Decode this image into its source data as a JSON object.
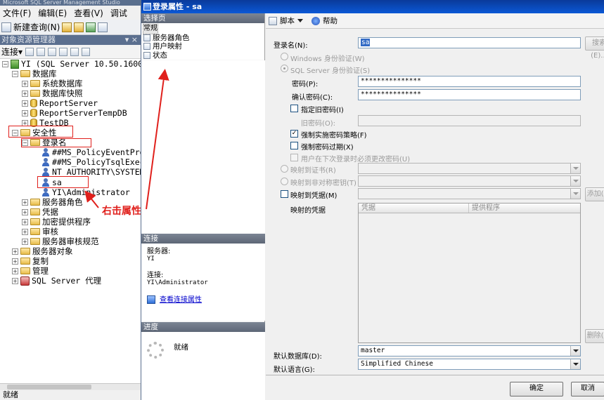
{
  "ssms": {
    "title": "Microsoft SQL Server Management Studio",
    "menu": [
      "文件(F)",
      "编辑(E)",
      "查看(V)",
      "调试"
    ],
    "toolbar_new_query": "新建查询(N)",
    "object_explorer_title": "对象资源管理器",
    "pin": "▾ ×",
    "connect_label": "连接▾",
    "status": "就绪"
  },
  "tree": {
    "server": "YI (SQL Server 10.50.1600 -",
    "databases": "数据库",
    "system_databases": "系统数据库",
    "db_snapshots": "数据库快照",
    "report_server": "ReportServer",
    "report_server_temp": "ReportServerTempDB",
    "testdb": "TestDB",
    "security": "安全性",
    "logins": "登录名",
    "login_1": "##MS_PolicyEventProc",
    "login_2": "##MS_PolicyTsqlExecu",
    "login_3": "NT AUTHORITY\\SYSTEM",
    "login_sa": "sa",
    "login_admin": "YI\\Administrator",
    "server_roles": "服务器角色",
    "credentials": "凭据",
    "crypto_providers": "加密提供程序",
    "audits": "审核",
    "audit_specs": "服务器审核规范",
    "server_objects": "服务器对象",
    "replication": "复制",
    "management": "管理",
    "agent": "SQL Server 代理"
  },
  "annotation": "右击属性",
  "dialog": {
    "title": "登录属性 - sa",
    "select_page": "选择页",
    "pages": [
      "常规",
      "服务器角色",
      "用户映射",
      "状态"
    ],
    "connection_header": "连接",
    "server_label": "服务器:",
    "server_value": "YI",
    "connection_label": "连接:",
    "connection_value": "YI\\Administrator",
    "view_conn_props": "查看连接属性",
    "progress_header": "进度",
    "progress_status": "就绪",
    "script": "脚本",
    "help": "帮助",
    "login_name_label": "登录名(N):",
    "login_name_value": "sa",
    "search_button": "搜索(E)...",
    "windows_auth": "Windows 身份验证(W)",
    "sql_auth": "SQL Server 身份验证(S)",
    "password_label": "密码(P):",
    "password_value": "***************",
    "confirm_label": "确认密码(C):",
    "confirm_value": "***************",
    "specify_old": "指定旧密码(I)",
    "old_password_label": "旧密码(O):",
    "enforce_policy": "强制实施密码策略(F)",
    "enforce_expiration": "强制密码过期(X)",
    "must_change": "用户在下次登录时必须更改密码(U)",
    "map_cert": "映射到证书(R)",
    "map_asym": "映射到非对称密钥(T)",
    "map_credential": "映射到凭据(M)",
    "add_button": "添加(A)",
    "mapped_credentials": "映射的凭据",
    "col_credential": "凭据",
    "col_provider": "提供程序",
    "remove_button": "删除(V)",
    "default_db_label": "默认数据库(D):",
    "default_db_value": "master",
    "default_lang_label": "默认语言(G):",
    "default_lang_value": "Simplified Chinese",
    "ok_button": "确定",
    "cancel_button": "取消"
  }
}
